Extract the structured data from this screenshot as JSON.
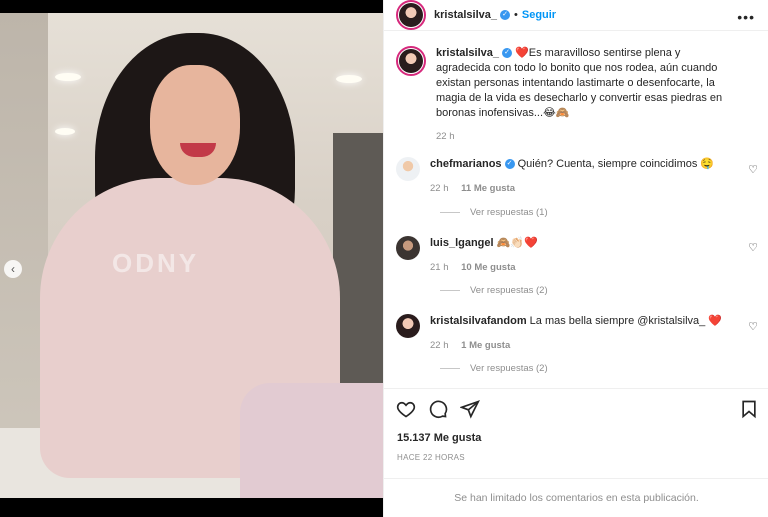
{
  "header": {
    "username": "kristalsilva_",
    "dot": "•",
    "follow_label": "Seguir",
    "more_label": "•••"
  },
  "caption": {
    "username": "kristalsilva_",
    "text": "❤️Es maravilloso sentirse plena y agradecida con todo lo bonito que nos rodea, aún cuando existan personas intentando lastimarte o desenfocarte, la magia de la vida es desecharlo y convertir esas piedras en boronas inofensivas...😂🙈",
    "time": "22 h"
  },
  "comments": [
    {
      "username": "chefmarianos",
      "verified": true,
      "text": "Quién? Cuenta, siempre coincidimos 🤤",
      "time": "22 h",
      "likes": "11 Me gusta",
      "replies": "Ver respuestas (1)"
    },
    {
      "username": "luis_lgangel",
      "verified": false,
      "text": "🙈👏🏻❤️",
      "time": "21 h",
      "likes": "10 Me gusta",
      "replies": "Ver respuestas (2)"
    },
    {
      "username": "kristalsilvafandom",
      "verified": false,
      "text": "La mas bella siempre @kristalsilva_ ❤️",
      "time": "22 h",
      "likes": "1 Me gusta",
      "replies": "Ver respuestas (2)"
    }
  ],
  "actions": {
    "icons": [
      "heart-icon",
      "comment-icon",
      "share-icon",
      "bookmark-icon"
    ],
    "likes_total": "15.137 Me gusta",
    "time_ago": "HACE 22 HORAS"
  },
  "footer": {
    "limited_text": "Se han limitado los comentarios en esta publicación."
  },
  "photo": {
    "print_text": "ODNY",
    "carousel_prev": "‹"
  },
  "colors": {
    "link": "#0095f6",
    "verified": "#3897f0",
    "story_ring": "#d6297c",
    "muted": "#8e8e8e"
  }
}
